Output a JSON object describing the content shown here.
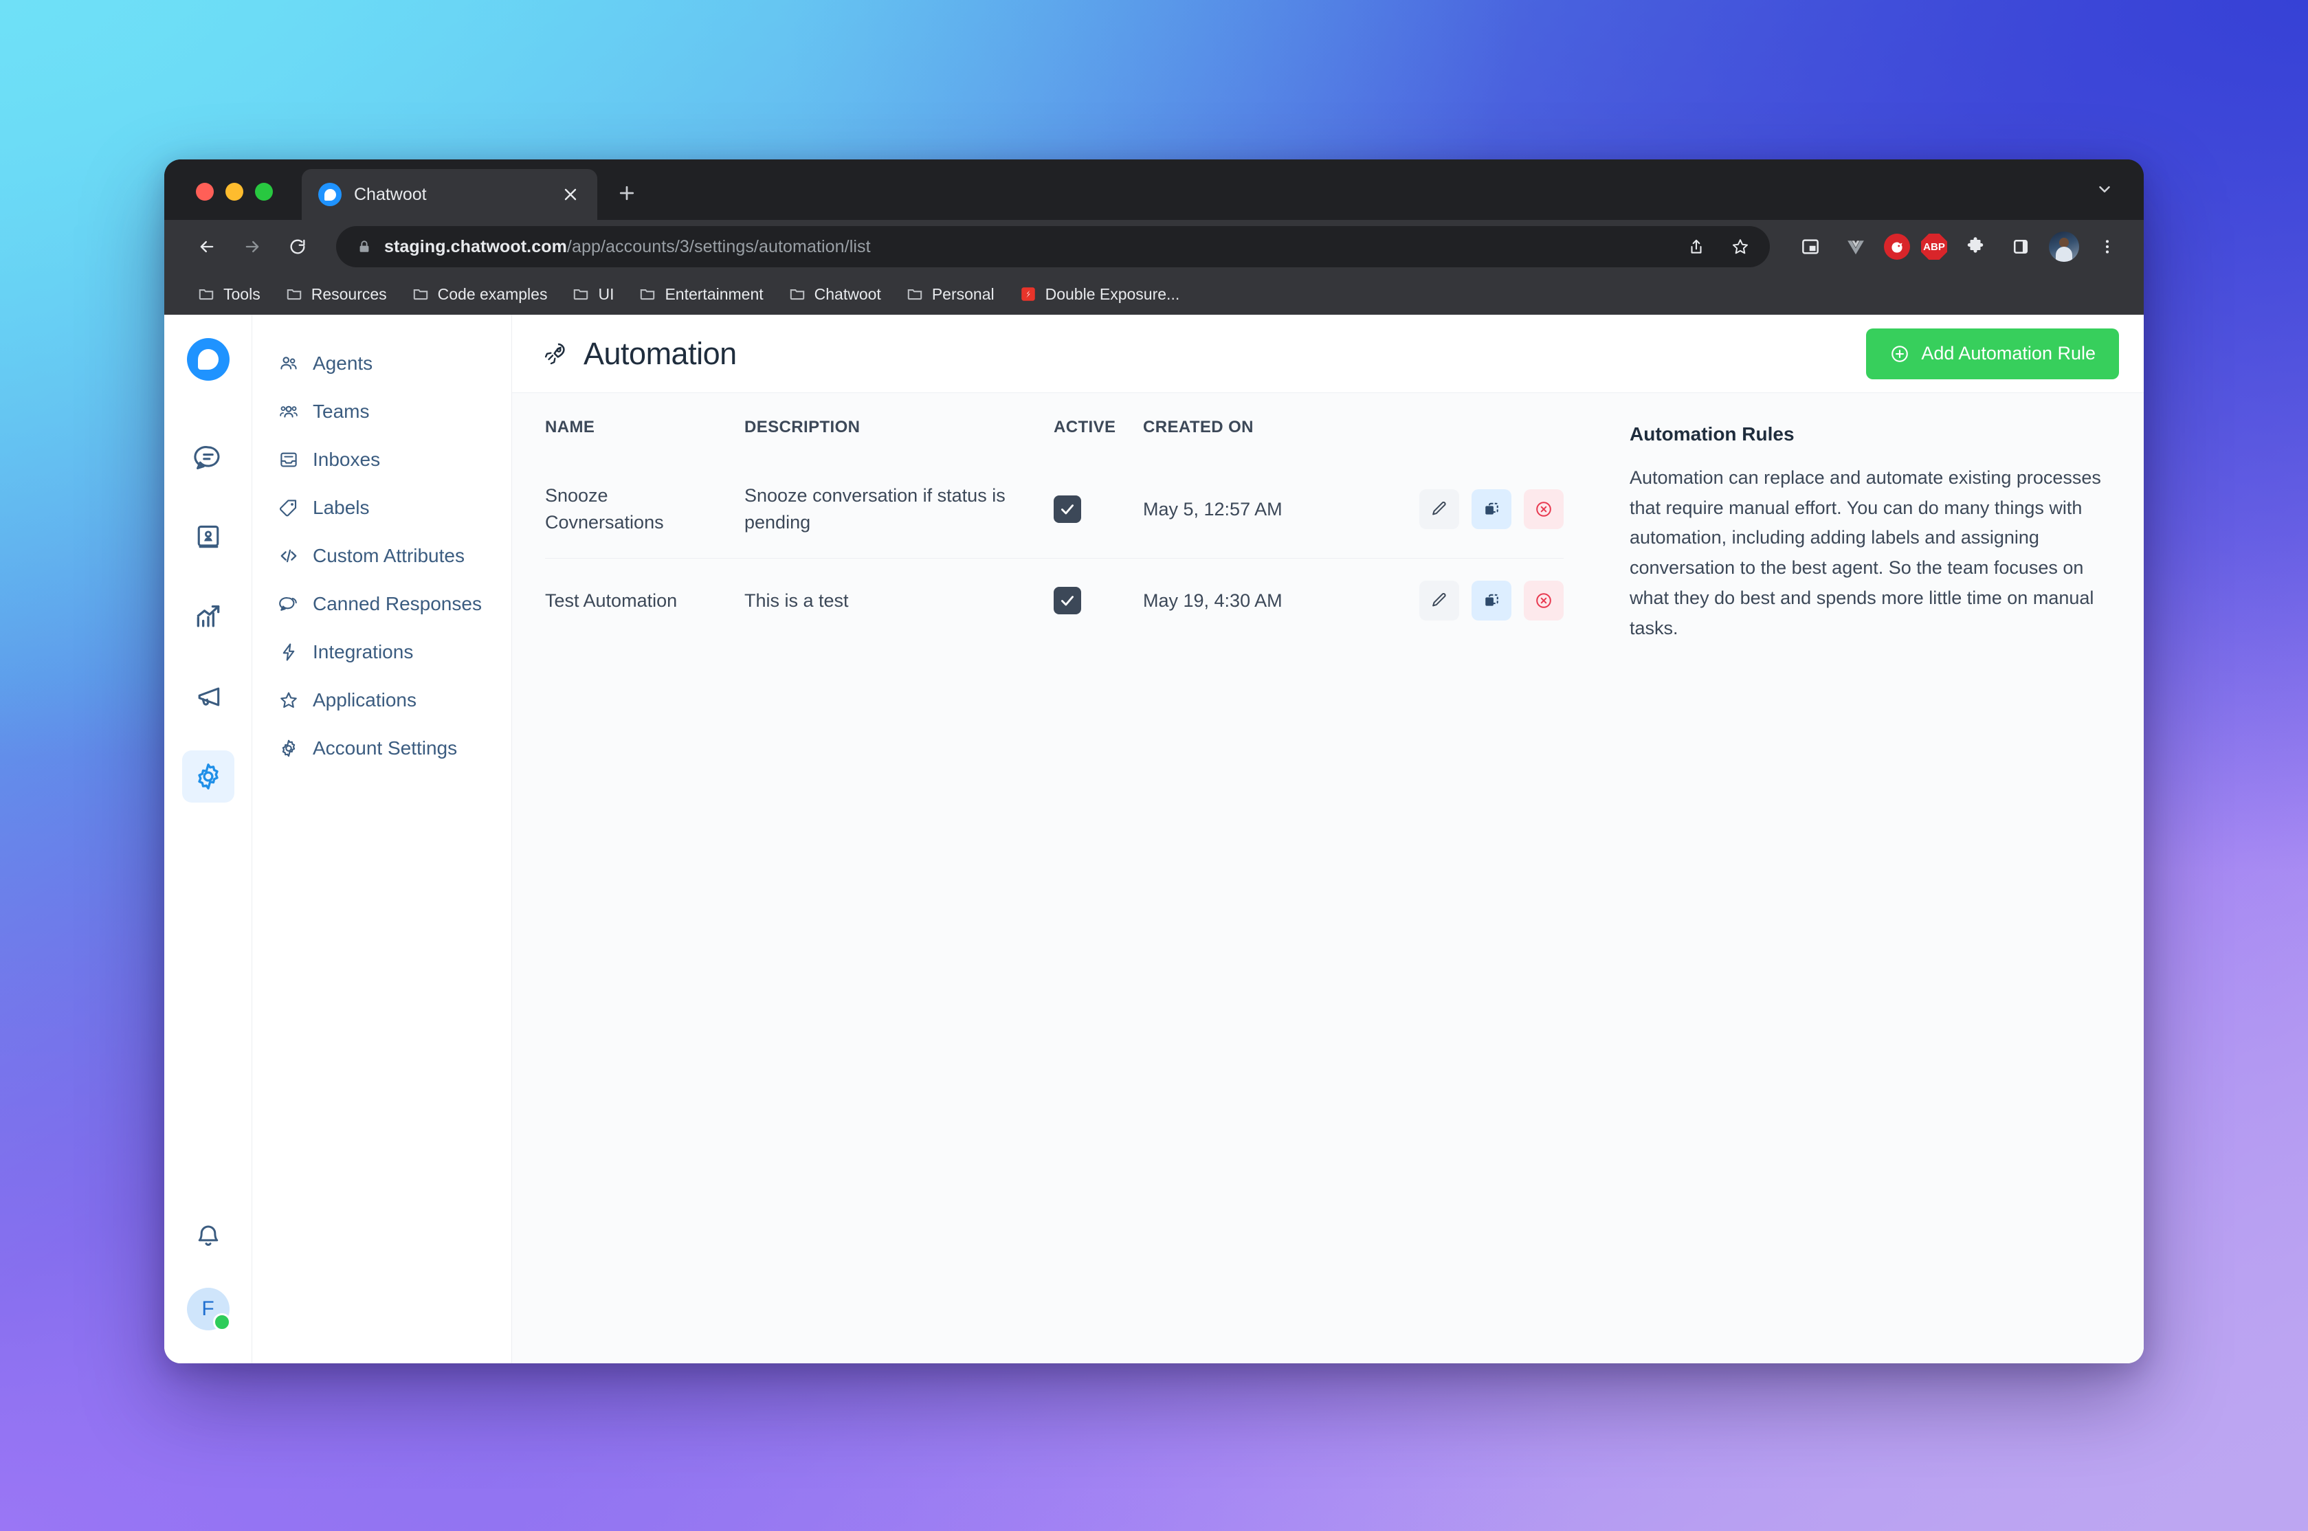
{
  "browser": {
    "tab": {
      "title": "Chatwoot",
      "favicon": "chatwoot-logo-icon",
      "close": "close-icon"
    },
    "new_tab_label": "+",
    "tab_search": "chevron-down-icon",
    "nav": {
      "back": "back-arrow-icon",
      "forward": "forward-arrow-icon",
      "reload": "reload-icon"
    },
    "omnibox": {
      "lock": "lock-icon",
      "url_host": "staging.chatwoot.com",
      "url_path": "/app/accounts/3/settings/automation/list",
      "share": "share-icon",
      "bookmark": "star-icon"
    },
    "extensions": [
      {
        "name": "picture-in-picture-icon",
        "label": ""
      },
      {
        "name": "vue-devtools-icon",
        "label": ""
      },
      {
        "name": "pet-extension-icon",
        "label": ""
      },
      {
        "name": "adblock-plus-icon",
        "label": "ABP"
      },
      {
        "name": "puzzle-extensions-icon",
        "label": ""
      },
      {
        "name": "side-panel-icon",
        "label": ""
      },
      {
        "name": "profile-avatar-icon",
        "label": ""
      },
      {
        "name": "chrome-menu-icon",
        "label": ""
      }
    ],
    "bookmarks": [
      {
        "label": "Tools",
        "icon": "folder-icon"
      },
      {
        "label": "Resources",
        "icon": "folder-icon"
      },
      {
        "label": "Code examples",
        "icon": "folder-icon"
      },
      {
        "label": "UI",
        "icon": "folder-icon"
      },
      {
        "label": "Entertainment",
        "icon": "folder-icon"
      },
      {
        "label": "Chatwoot",
        "icon": "folder-icon"
      },
      {
        "label": "Personal",
        "icon": "folder-icon"
      },
      {
        "label": "Double Exposure...",
        "icon": "red-app-icon"
      }
    ]
  },
  "rail": {
    "logo": "chatwoot-logo",
    "items": [
      {
        "name": "conversations",
        "icon": "chat-bubble-icon"
      },
      {
        "name": "contacts",
        "icon": "contact-book-icon"
      },
      {
        "name": "reports",
        "icon": "bar-chart-icon"
      },
      {
        "name": "campaigns",
        "icon": "megaphone-icon"
      },
      {
        "name": "settings",
        "icon": "gear-icon",
        "active": true
      }
    ],
    "bell": "bell-icon",
    "avatar_initial": "F",
    "status": "online"
  },
  "subnav": {
    "items": [
      {
        "label": "Agents",
        "icon": "agents-icon"
      },
      {
        "label": "Teams",
        "icon": "teams-icon"
      },
      {
        "label": "Inboxes",
        "icon": "inbox-icon"
      },
      {
        "label": "Labels",
        "icon": "label-tag-icon"
      },
      {
        "label": "Custom Attributes",
        "icon": "code-brackets-icon"
      },
      {
        "label": "Canned Responses",
        "icon": "chat-reply-icon"
      },
      {
        "label": "Integrations",
        "icon": "lightning-icon"
      },
      {
        "label": "Applications",
        "icon": "star-outline-icon"
      },
      {
        "label": "Account Settings",
        "icon": "gear-icon"
      }
    ]
  },
  "page": {
    "icon": "automation-rocket-icon",
    "title": "Automation",
    "add_button": {
      "label": "Add Automation Rule",
      "icon": "plus-circle-icon",
      "color": "#37cf5c"
    }
  },
  "table": {
    "columns": [
      "NAME",
      "DESCRIPTION",
      "ACTIVE",
      "CREATED ON"
    ],
    "rows": [
      {
        "name": "Snooze Covnersations",
        "description": "Snooze conversation if status is pending",
        "active": true,
        "created_on": "May 5, 12:57 AM",
        "actions": [
          {
            "name": "edit",
            "icon": "pencil-icon"
          },
          {
            "name": "clone",
            "icon": "copy-icon"
          },
          {
            "name": "delete",
            "icon": "circle-x-icon"
          }
        ]
      },
      {
        "name": "Test Automation",
        "description": "This is a test",
        "active": true,
        "created_on": "May 19, 4:30 AM",
        "actions": [
          {
            "name": "edit",
            "icon": "pencil-icon"
          },
          {
            "name": "clone",
            "icon": "copy-icon"
          },
          {
            "name": "delete",
            "icon": "circle-x-icon"
          }
        ]
      }
    ]
  },
  "info_panel": {
    "heading": "Automation Rules",
    "body": "Automation can replace and automate existing processes that require manual effort. You can do many things with automation, including adding labels and assigning conversation to the best agent. So the team focuses on what they do best and spends more little time on manual tasks."
  }
}
